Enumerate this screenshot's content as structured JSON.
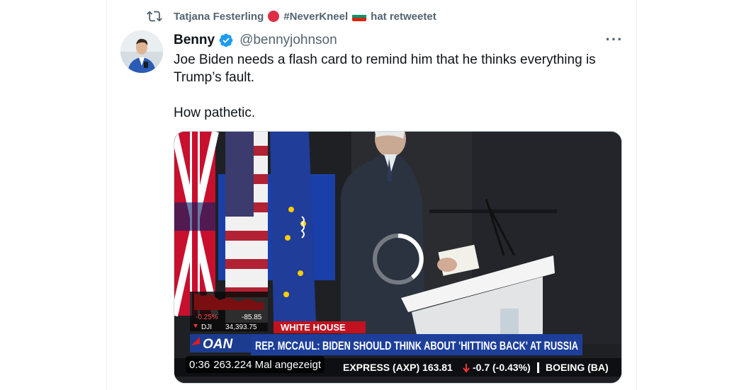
{
  "retweet": {
    "user": "Tatjana Festerling",
    "hashtag": "#NeverKneel",
    "suffix": "hat retweetet"
  },
  "tweet": {
    "display_name": "Benny",
    "handle": "@bennyjohnson",
    "text_line1": "Joe Biden needs a flash card to remind him that he thinks everything is",
    "text_line2": "Trump’s fault.",
    "text_line3": "How pathetic.",
    "more_label": "···"
  },
  "video": {
    "time": "0:36",
    "views": "263.224 Mal angezeigt",
    "lower_third_label": "WHITE HOUSE",
    "headline": "REP. MCCAUL: BIDEN SHOULD THINK ABOUT 'HITTING BACK' AT RUSSIA",
    "network": "OAN",
    "ticker_text": "EXPRESS (AXP)  163.81",
    "ticker_change": "-0.7 (-0.43%)",
    "ticker_next": "BOEING (BA)",
    "market_pct": "-0.25%",
    "market_change": "-85.85",
    "market_index": "DJI",
    "market_value": "34,393.75"
  },
  "colors": {
    "verified_blue": "#1d9bf0",
    "muted": "#536471",
    "text": "#0f1419"
  }
}
